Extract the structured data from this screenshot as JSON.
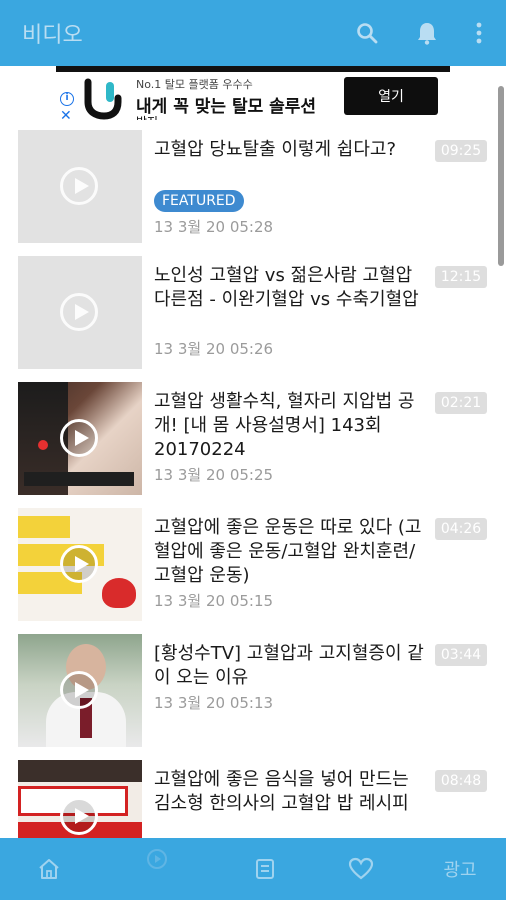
{
  "appbar": {
    "title": "비디오",
    "bg": "#3aa7e0"
  },
  "ad": {
    "line1": "No.1 탈모 플랫폼 우수수",
    "headline": "내게 꼭 맞는 탈모 솔루션",
    "line3": "받지",
    "cta": "열기",
    "info_icon": "i"
  },
  "videos": [
    {
      "title": "고혈압 당뇨탈출 이렇게 쉽다고?",
      "badge": "FEATURED",
      "date": "13 3월 20 05:28",
      "duration": "09:25"
    },
    {
      "title": "노인성 고혈압 vs 젊은사람 고혈압 다른점 - 이완기혈압 vs 수축기혈압",
      "date": "13 3월 20 05:26",
      "duration": "12:15"
    },
    {
      "title": "고혈압 생활수칙, 혈자리 지압법 공개! [내 몸 사용설명서] 143회 20170224",
      "date": "13 3월 20 05:25",
      "duration": "02:21"
    },
    {
      "title": "고혈압에 좋은 운동은 따로 있다 (고혈압에 좋은 운동/고혈압 완치훈련/고혈압 운동)",
      "date": "13 3월 20 05:15",
      "duration": "04:26"
    },
    {
      "title": "[황성수TV] 고혈압과 고지혈증이 같이 오는 이유",
      "date": "13 3월 20 05:13",
      "duration": "03:44"
    },
    {
      "title": "고혈압에 좋은 음식을 넣어 만드는 김소형 한의사의 고혈압 밥 레시피",
      "date": "",
      "duration": "08:48"
    }
  ],
  "bottom_nav": {
    "ad_label": "광고"
  }
}
